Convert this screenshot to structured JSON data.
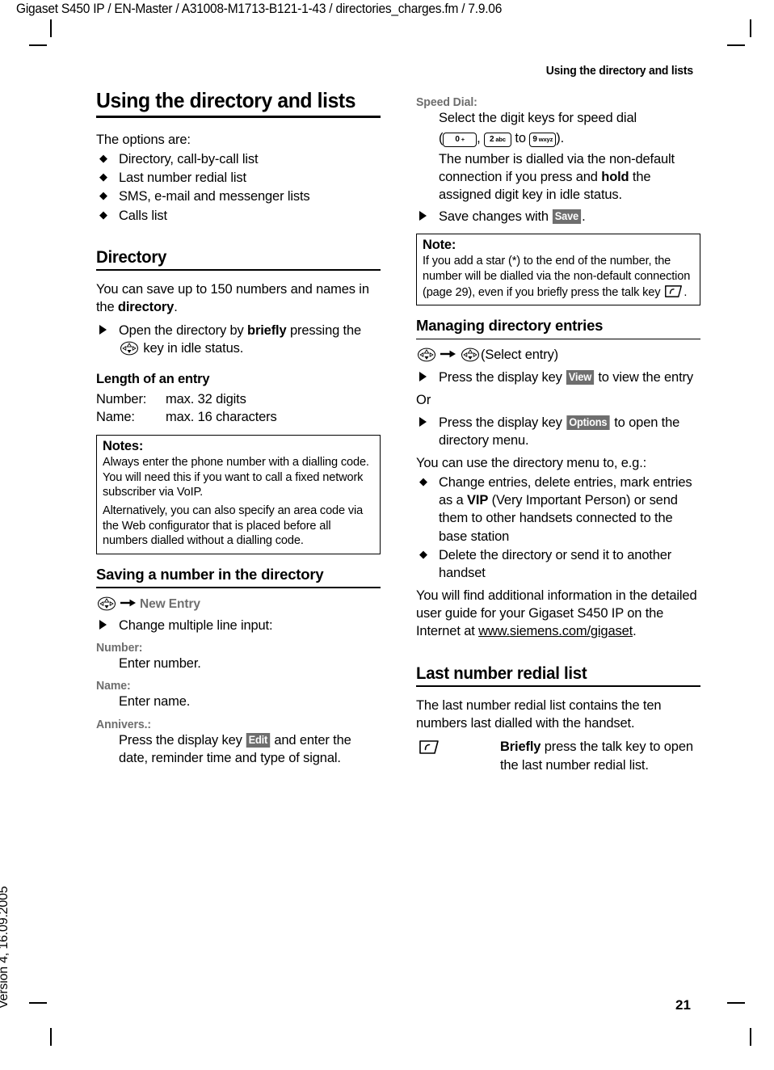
{
  "page": {
    "file_id_line": "Gigaset S450 IP / EN-Master / A31008-M1713-B121-1-43 / directories_charges.fm / 7.9.06",
    "running_head": "Using the directory and lists",
    "version_footer": "Version 4, 16.09.2005",
    "page_number": "21"
  },
  "left_column": {
    "title": "Using the directory and lists",
    "intro": "The options are:",
    "options": [
      "Directory, call-by-call list",
      "Last number redial list",
      "SMS, e-mail and messenger lists",
      "Calls list"
    ],
    "directory_heading": "Directory",
    "directory_intro_a": "You can save up to 150 numbers and names in the ",
    "directory_intro_b": "directory",
    "directory_intro_c": ".",
    "open_step_a": "Open the directory by ",
    "open_step_b": "briefly",
    "open_step_c": " pressing the ",
    "open_step_d": " key in idle status.",
    "length_heading": "Length of an entry",
    "length_rows": [
      {
        "label": "Number:",
        "value": "max. 32 digits"
      },
      {
        "label": "Name:",
        "value": "max. 16 characters"
      }
    ],
    "notes_box": {
      "title": "Notes:",
      "paragraphs": [
        "Always enter the phone number with a dialling code. You will need this if you want to call a fixed network subscriber via VoIP.",
        "Alternatively, you can also specify an area code via the Web configurator that is placed before all numbers dialled without a dialling code."
      ]
    },
    "saving_heading": "Saving a number in the directory",
    "menu_path_item": "New Entry",
    "change_step": "Change multiple line input:",
    "params": [
      {
        "label": "Number:",
        "text": "Enter number."
      },
      {
        "label": "Name:",
        "text": "Enter name."
      }
    ],
    "annivers_label": "Annivers.:",
    "annivers_text_a": "Press the display key ",
    "annivers_key": "Edit",
    "annivers_text_b": " and enter the date, reminder time and type of signal."
  },
  "right_column": {
    "speed_dial_label": "Speed Dial:",
    "speed_dial_line1": "Select the digit keys for speed dial",
    "speed_dial_keys": {
      "open_paren": "(",
      "key0_main": "0",
      "key0_sub": "+",
      "comma": ", ",
      "key2_main": "2",
      "key2_sub": "abc",
      "to": " to ",
      "key9_main": "9",
      "key9_sub": "wxyz",
      "close_paren": ")."
    },
    "speed_dial_body_a": "The number is dialled via the non-default connection if you press and ",
    "speed_dial_body_b": "hold",
    "speed_dial_body_c": " the assigned digit key in idle status.",
    "save_step_a": "Save changes with ",
    "save_step_key": "Save",
    "save_step_b": ".",
    "note_box": {
      "title": "Note:",
      "text_a": "If you add a star (*) to the end of the number, the number will be dialled via the non-default connection (page 29), even if you briefly press the talk key ",
      "text_b": "."
    },
    "managing_heading": "Managing directory entries",
    "managing_path_suffix": "(Select entry)",
    "view_step_a": "Press the display key ",
    "view_step_key": "View",
    "view_step_b": " to view the entry",
    "or_text": "Or",
    "options_step_a": "Press the display key ",
    "options_step_key": "Options",
    "options_step_b": " to open the directory menu.",
    "menu_use_intro": "You can use the directory menu to, e.g.:",
    "menu_use_items": [
      {
        "a": "Change entries, delete entries, mark entries as a ",
        "b": "VIP",
        "c": " (Very Important Person) or send them to other handsets connected to the base station"
      },
      {
        "a": "Delete the directory or send it to another handset",
        "b": "",
        "c": ""
      }
    ],
    "additional_info_a": "You will find additional information in the detailed user guide for your Gigaset S450 IP on the Internet at ",
    "additional_info_link": "www.siemens.com/gigaset",
    "additional_info_b": ".",
    "redial_heading": "Last number redial list",
    "redial_intro": "The last number redial list contains the ten numbers last dialled with the handset.",
    "redial_step_a": "Briefly",
    "redial_step_b": " press the talk key to open the last number redial list."
  },
  "icons": {
    "nav_key": "navigation-key-icon",
    "talk_key": "talk-key-icon",
    "arrow": "right-arrow-icon",
    "diamond_bullet": "◆",
    "triangle_bullet": "triangle-bullet-icon"
  },
  "colors": {
    "text": "#000000",
    "gray_label": "#6e6e6e",
    "softkey_bg": "#6e6e6e",
    "softkey_fg": "#ffffff",
    "page_bg": "#ffffff"
  }
}
